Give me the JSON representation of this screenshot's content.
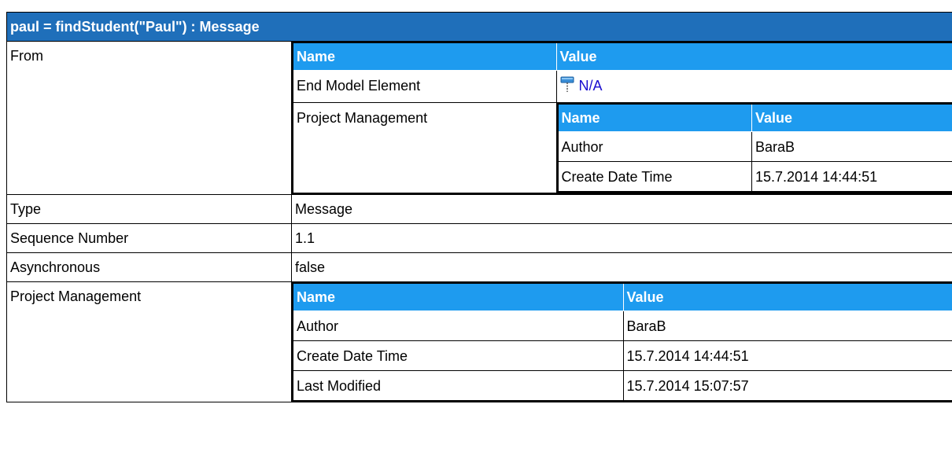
{
  "title": "paul = findStudent(\"Paul\") : Message",
  "from": {
    "label": "From",
    "name_header": "Name",
    "value_header": "Value",
    "end_model_element": {
      "label": "End Model Element",
      "value": "N/A",
      "icon": "pin-icon"
    },
    "project_management": {
      "label": "Project Management",
      "name_header": "Name",
      "value_header": "Value",
      "rows": [
        {
          "name": "Author",
          "value": "BaraB"
        },
        {
          "name": "Create Date Time",
          "value": "15.7.2014 14:44:51"
        }
      ]
    }
  },
  "type": {
    "label": "Type",
    "value": "Message"
  },
  "sequence_number": {
    "label": "Sequence Number",
    "value": "1.1"
  },
  "asynchronous": {
    "label": "Asynchronous",
    "value": "false"
  },
  "project_management": {
    "label": "Project Management",
    "name_header": "Name",
    "value_header": "Value",
    "rows": [
      {
        "name": "Author",
        "value": "BaraB"
      },
      {
        "name": "Create Date Time",
        "value": "15.7.2014 14:44:51"
      },
      {
        "name": "Last Modified",
        "value": "15.7.2014 15:07:57"
      }
    ]
  }
}
